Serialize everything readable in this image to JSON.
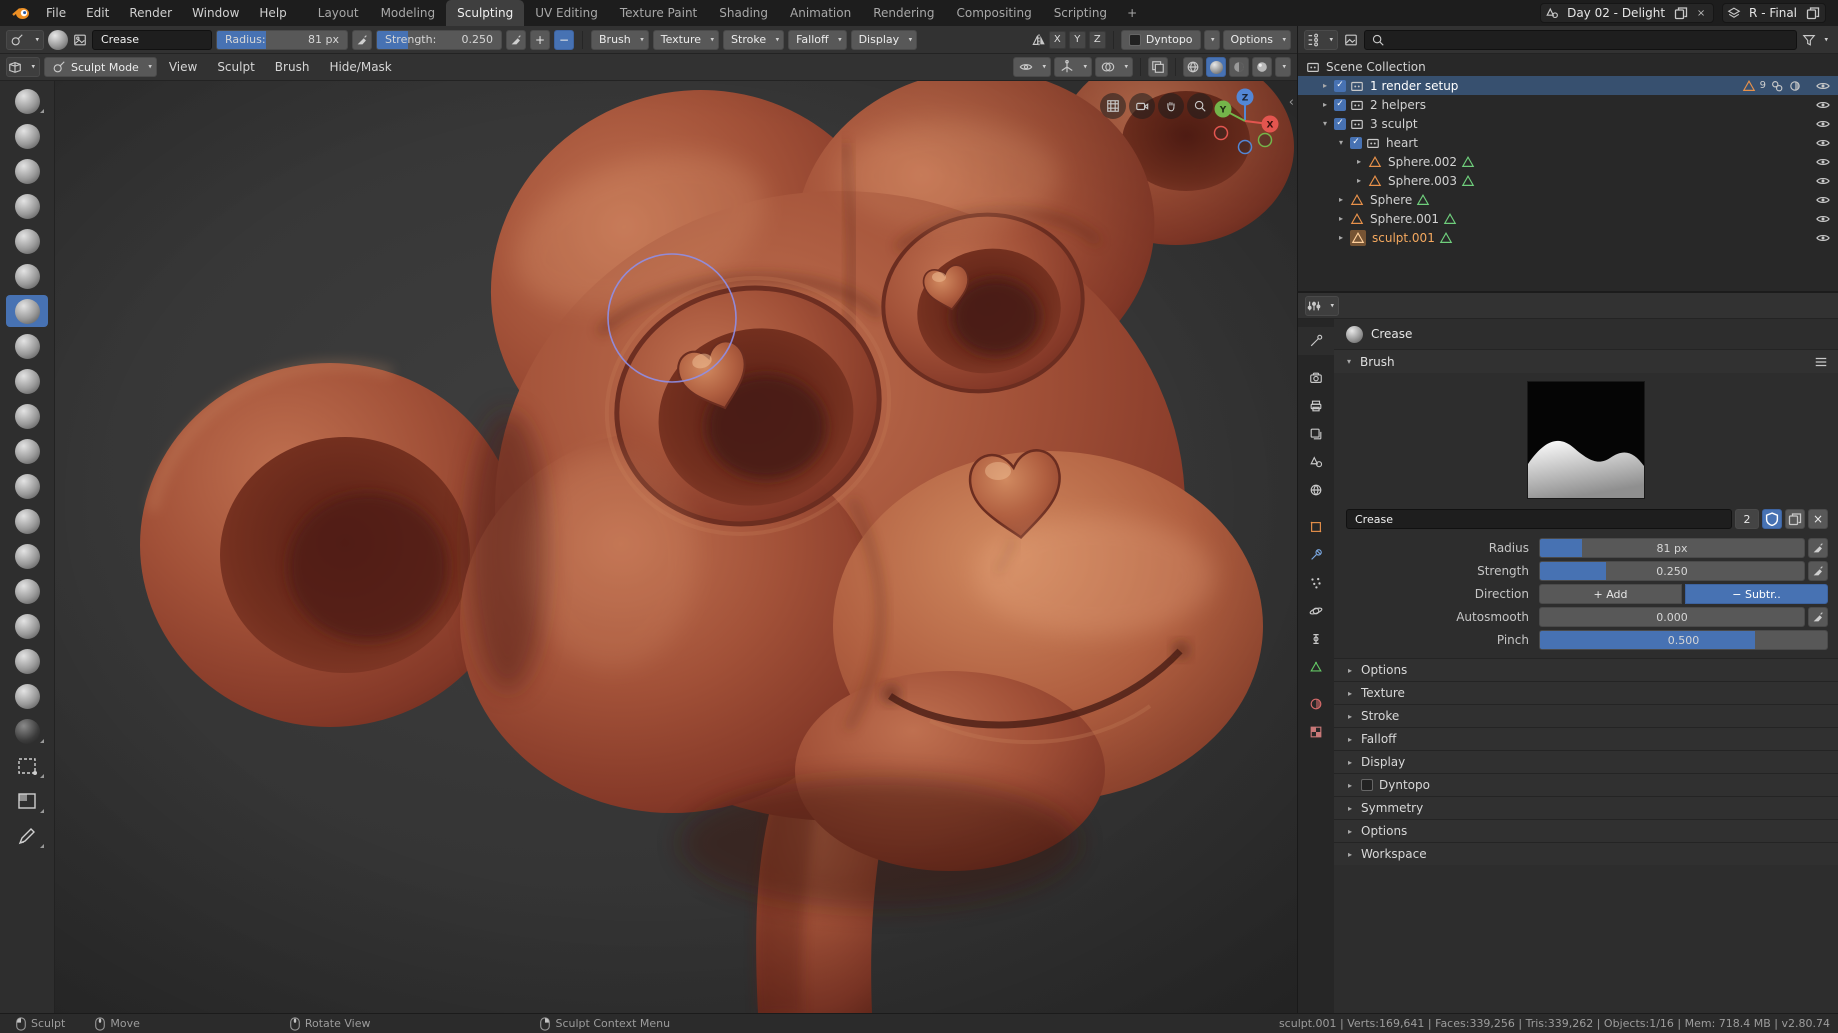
{
  "glyphs": {
    "chevron": "▾",
    "collapse": "▸",
    "expand": "▾",
    "check": "✓",
    "close": "×",
    "back": "‹"
  },
  "colors": {
    "accent": "#4772b3",
    "active_object_text": "#f5a95f",
    "clay": "#a25138",
    "selection_row": "#37506f"
  },
  "icons": {
    "search": "magnifier",
    "filter": "funnel",
    "eye": "visibility",
    "stylus": "pen-pressure",
    "copy": "duplicate",
    "mesh_object": "orange-triangle",
    "mesh_data": "green-triangle",
    "collection": "box",
    "mouse_left": "LMB",
    "mouse_middle": "MMB",
    "mouse_right": "RMB"
  },
  "topbar": {
    "menus": [
      "File",
      "Edit",
      "Render",
      "Window",
      "Help"
    ],
    "workspaces": [
      "Layout",
      "Modeling",
      "Sculpting",
      "UV Editing",
      "Texture Paint",
      "Shading",
      "Animation",
      "Rendering",
      "Compositing",
      "Scripting"
    ],
    "active_workspace": "Sculpting",
    "add_workspace": "+",
    "scene_name": "Day 02 - Delight",
    "view_layer_name": "R - Final"
  },
  "tool_header": {
    "brush_name": "Crease",
    "radius": {
      "label": "Radius:",
      "value": "81 px",
      "fill": "width:38%"
    },
    "strength": {
      "label": "Strength:",
      "value": "0.250",
      "fill": "width:25%"
    },
    "add": "+",
    "subtract": "−",
    "menus": [
      "Brush",
      "Texture",
      "Stroke",
      "Falloff",
      "Display"
    ],
    "mirror": {
      "x": "X",
      "y": "Y",
      "z": "Z"
    },
    "dyntopo": "Dyntopo",
    "options": "Options"
  },
  "viewport_header": {
    "mode": "Sculpt Mode",
    "menus": [
      "View",
      "Sculpt",
      "Brush",
      "Hide/Mask"
    ]
  },
  "toolbar": {
    "brushes": [
      "draw",
      "clay",
      "clay-strips",
      "layer",
      "inflate",
      "blob",
      "crease",
      "smooth",
      "flatten",
      "fill",
      "scrape",
      "pinch",
      "grab",
      "elastic-deform",
      "snake-hook",
      "thumb",
      "nudge",
      "rotate",
      "mask",
      "box-mask",
      "box-hide",
      "annotate"
    ],
    "active_brush": "crease"
  },
  "viewport": {
    "axes": {
      "x": "X",
      "y": "Y",
      "z": "Z"
    }
  },
  "outliner": {
    "root_label": "Scene Collection",
    "items": [
      {
        "label": "1 render setup",
        "count": "9"
      },
      {
        "label": "2 helpers"
      },
      {
        "label": "3 sculpt"
      },
      {
        "label": "heart"
      },
      {
        "label": "Sphere.002"
      },
      {
        "label": "Sphere.003"
      },
      {
        "label": "Sphere"
      },
      {
        "label": "Sphere.001"
      },
      {
        "label": "sculpt.001"
      }
    ]
  },
  "properties": {
    "tool_label": "Crease",
    "brush_panel": "Brush",
    "name_field": {
      "value": "Crease",
      "users": "2"
    },
    "radius": {
      "label": "Radius",
      "value": "81 px",
      "fill": "width:16%"
    },
    "strength": {
      "label": "Strength",
      "value": "0.250",
      "fill": "width:25%"
    },
    "direction": {
      "label": "Direction",
      "add": "+ Add",
      "subtract": "− Subtr..",
      "active": "subtract"
    },
    "autosmooth": {
      "label": "Autosmooth",
      "value": "0.000",
      "fill": "width:0%"
    },
    "pinch": {
      "label": "Pinch",
      "value": "0.500",
      "fill": "width:75%"
    },
    "panels": [
      "Options",
      "Texture",
      "Stroke",
      "Falloff",
      "Display",
      "Dyntopo",
      "Symmetry",
      "Options",
      "Workspace"
    ]
  },
  "statusbar": {
    "hints": [
      {
        "label": "Sculpt"
      },
      {
        "label": "Move"
      },
      {
        "label": "Rotate View"
      },
      {
        "label": "Sculpt Context Menu"
      }
    ],
    "stats": "sculpt.001 | Verts:169,641 | Faces:339,256 | Tris:339,262 | Objects:1/16 | Mem: 718.4 MB | v2.80.74"
  }
}
